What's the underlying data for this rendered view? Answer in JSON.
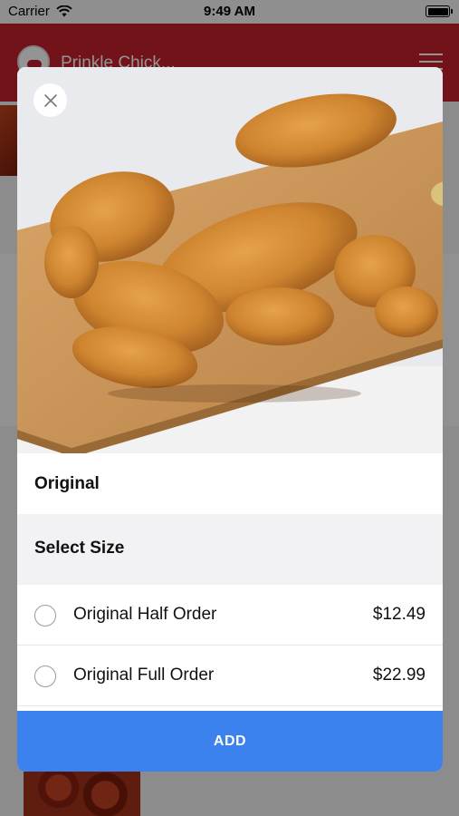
{
  "status_bar": {
    "carrier": "Carrier",
    "time": "9:49 AM",
    "icons": [
      "wifi-icon",
      "battery-icon"
    ]
  },
  "app": {
    "title": "Prinkle Chick...",
    "brand_color": "#c41f2b",
    "icons": [
      "logo-icon",
      "menu-icon"
    ]
  },
  "modal": {
    "close_icon": "close-icon",
    "item_name": "Original",
    "size_section_title": "Select Size",
    "options": [
      {
        "label": "Original Half Order",
        "price": "$12.49",
        "selected": false
      },
      {
        "label": "Original Full Order",
        "price": "$22.99",
        "selected": false
      }
    ],
    "add_button_label": "ADD",
    "accent_color": "#3b82ee"
  }
}
